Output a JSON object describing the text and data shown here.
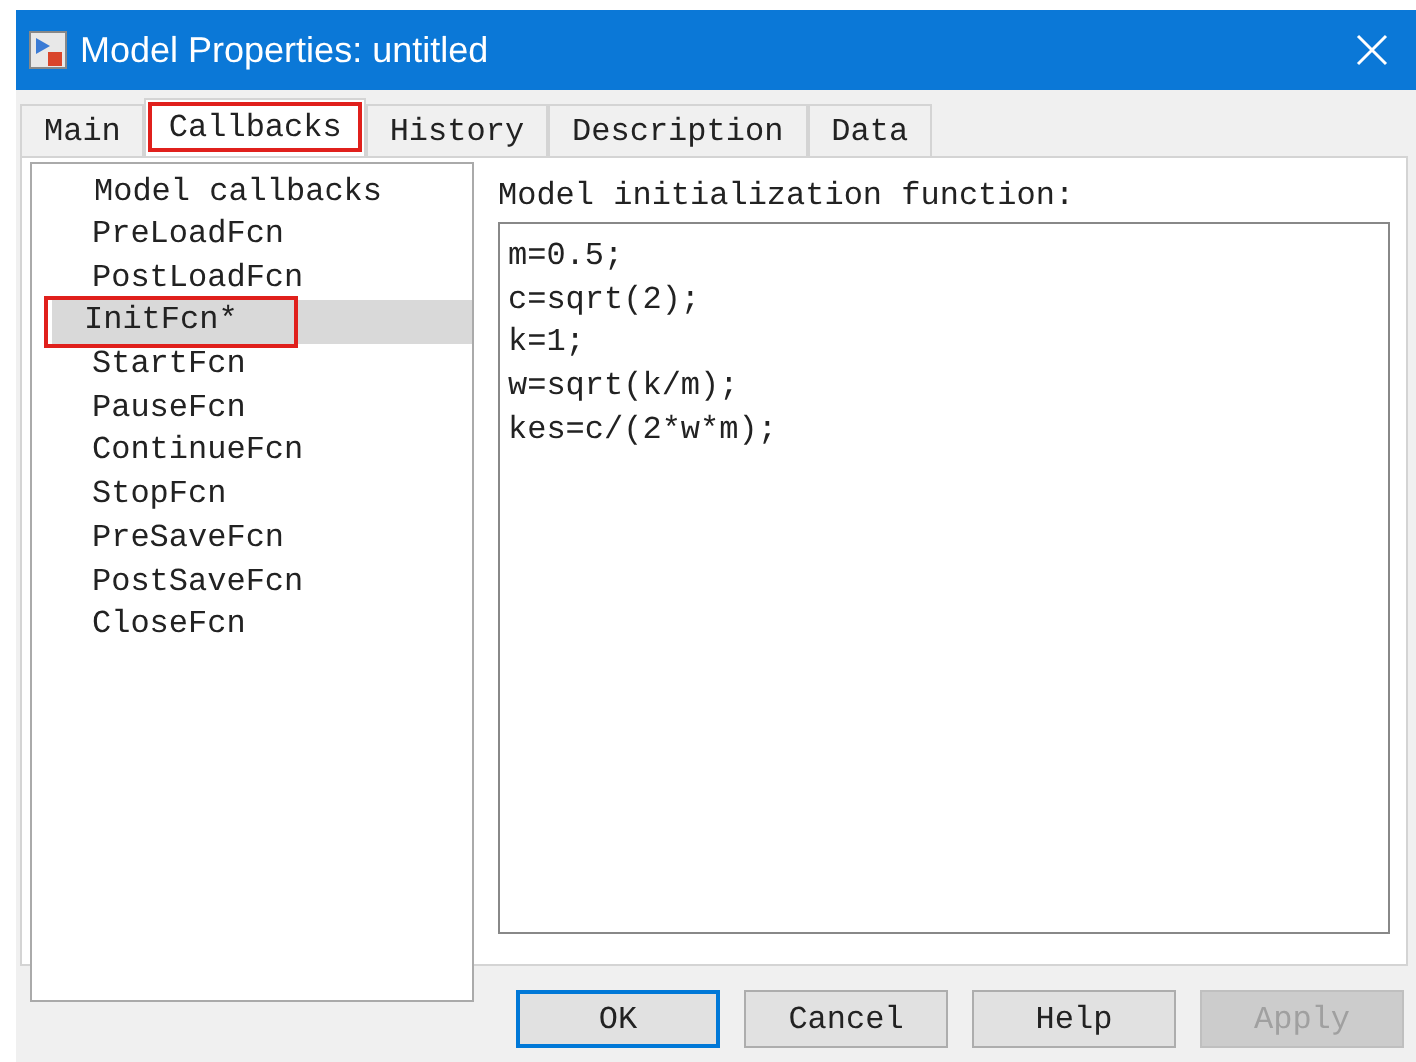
{
  "window": {
    "title": "Model Properties: untitled"
  },
  "tabs": [
    {
      "label": "Main",
      "selected": false,
      "highlighted": false
    },
    {
      "label": "Callbacks",
      "selected": true,
      "highlighted": true
    },
    {
      "label": "History",
      "selected": false,
      "highlighted": false
    },
    {
      "label": "Description",
      "selected": false,
      "highlighted": false
    },
    {
      "label": "Data",
      "selected": false,
      "highlighted": false
    }
  ],
  "callbacks": {
    "heading": "Model callbacks",
    "items": [
      {
        "label": "PreLoadFcn",
        "selected": false,
        "highlighted": false
      },
      {
        "label": "PostLoadFcn",
        "selected": false,
        "highlighted": false
      },
      {
        "label": "InitFcn*",
        "selected": true,
        "highlighted": true
      },
      {
        "label": "StartFcn",
        "selected": false,
        "highlighted": false
      },
      {
        "label": "PauseFcn",
        "selected": false,
        "highlighted": false
      },
      {
        "label": "ContinueFcn",
        "selected": false,
        "highlighted": false
      },
      {
        "label": "StopFcn",
        "selected": false,
        "highlighted": false
      },
      {
        "label": "PreSaveFcn",
        "selected": false,
        "highlighted": false
      },
      {
        "label": "PostSaveFcn",
        "selected": false,
        "highlighted": false
      },
      {
        "label": "CloseFcn",
        "selected": false,
        "highlighted": false
      }
    ]
  },
  "editor": {
    "label": "Model initialization function:",
    "lines": [
      "m=0.5;",
      "c=sqrt(2);",
      "k=1;",
      "w=sqrt(k/m);",
      "kes=c/(2*w*m);"
    ]
  },
  "buttons": [
    {
      "label": "OK",
      "disabled": false,
      "default": true
    },
    {
      "label": "Cancel",
      "disabled": false,
      "default": false
    },
    {
      "label": "Help",
      "disabled": false,
      "default": false
    },
    {
      "label": "Apply",
      "disabled": true,
      "default": false
    }
  ]
}
